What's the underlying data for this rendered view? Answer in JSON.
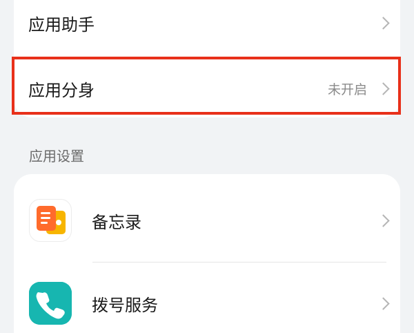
{
  "top_card": {
    "items": [
      {
        "label": "应用助手",
        "value": ""
      },
      {
        "label": "应用分身",
        "value": "未开启"
      }
    ]
  },
  "section": {
    "title": "应用设置"
  },
  "apps": [
    {
      "label": "备忘录",
      "icon": "memo-icon"
    },
    {
      "label": "拨号服务",
      "icon": "phone-icon"
    }
  ],
  "colors": {
    "highlight_border": "#e8301a",
    "memo_orange": "#ff6b2c",
    "memo_yellow": "#f7b500",
    "phone_teal": "#17b6b0"
  }
}
